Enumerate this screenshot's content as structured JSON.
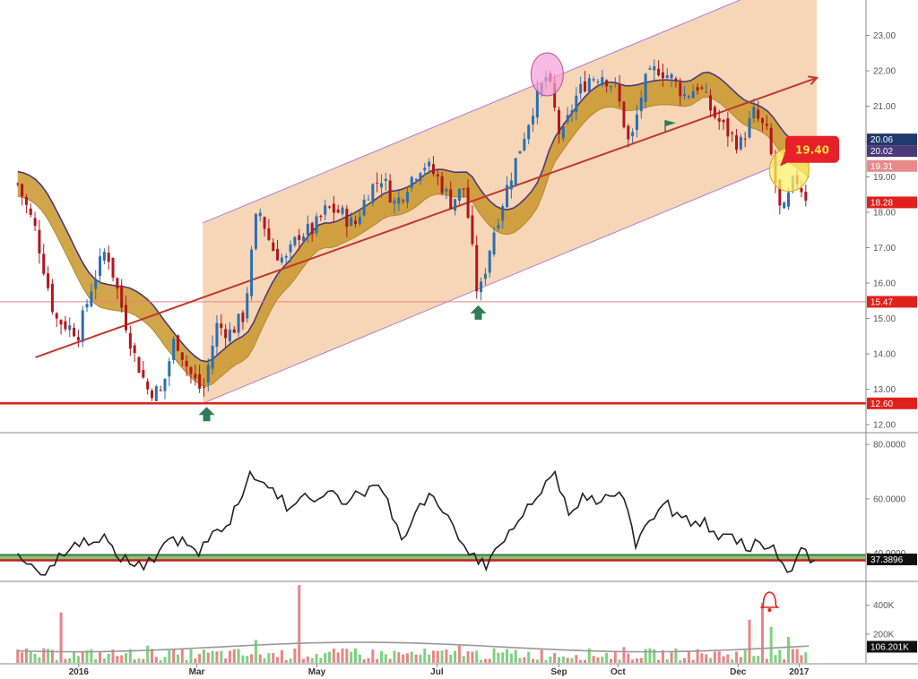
{
  "colors": {
    "channel_fill": "#f4c8a0",
    "channel_edge": "#b07ad8",
    "band_fill": "#c9962a",
    "band_edge": "#4a3a7a",
    "trend_line": "#c0392b",
    "support_line": "#e0201a",
    "candle_up": "#2a6fb0",
    "candle_down": "#b0171c",
    "vol_up": "#7ed17e",
    "vol_down": "#e98585",
    "rsi_line": "#222222",
    "rsi_band": "#8fbf7a"
  },
  "markers": {
    "arrow_up_icon": "arrow-up-icon",
    "arrow_down_icon": "arrow-down-icon",
    "flag_icon": "flag-icon",
    "bell_icon": "bell-icon"
  },
  "chart_data": [
    {
      "type": "candlestick",
      "panel": "price",
      "ylim": [
        12.0,
        24.0
      ],
      "y_ticks": [
        "24.00",
        "23.00",
        "22.00",
        "21.00",
        "20.00",
        "19.00",
        "18.00",
        "17.00",
        "16.00",
        "15.00",
        "14.00",
        "13.00",
        "12.00"
      ],
      "x_ticks": [
        "2016",
        "Mar",
        "May",
        "Jul",
        "Sep",
        "Oct",
        "Dec",
        "2017"
      ],
      "price_path": [
        [
          "2015-12-01",
          18.8
        ],
        [
          "2015-12-10",
          17.5
        ],
        [
          "2015-12-20",
          15.0
        ],
        [
          "2016-01-01",
          14.6
        ],
        [
          "2016-01-08",
          16.0
        ],
        [
          "2016-01-15",
          17.0
        ],
        [
          "2016-01-22",
          15.5
        ],
        [
          "2016-01-29",
          14.0
        ],
        [
          "2016-02-05",
          13.0
        ],
        [
          "2016-02-12",
          12.9
        ],
        [
          "2016-02-19",
          14.5
        ],
        [
          "2016-02-26",
          13.5
        ],
        [
          "2016-03-04",
          12.9
        ],
        [
          "2016-03-11",
          14.8
        ],
        [
          "2016-03-18",
          14.6
        ],
        [
          "2016-03-25",
          15.1
        ],
        [
          "2016-04-01",
          18.2
        ],
        [
          "2016-04-08",
          17.0
        ],
        [
          "2016-04-15",
          16.6
        ],
        [
          "2016-04-22",
          17.4
        ],
        [
          "2016-04-29",
          17.5
        ],
        [
          "2016-05-06",
          18.1
        ],
        [
          "2016-05-13",
          18.0
        ],
        [
          "2016-05-20",
          17.6
        ],
        [
          "2016-05-27",
          18.6
        ],
        [
          "2016-06-03",
          19.0
        ],
        [
          "2016-06-10",
          18.2
        ],
        [
          "2016-06-17",
          18.9
        ],
        [
          "2016-06-24",
          19.4
        ],
        [
          "2016-07-01",
          19.0
        ],
        [
          "2016-07-08",
          18.3
        ],
        [
          "2016-07-15",
          18.7
        ],
        [
          "2016-07-22",
          15.5
        ],
        [
          "2016-07-29",
          17.3
        ],
        [
          "2016-08-05",
          18.6
        ],
        [
          "2016-08-12",
          19.8
        ],
        [
          "2016-08-19",
          21.0
        ],
        [
          "2016-08-26",
          21.9
        ],
        [
          "2016-09-02",
          20.0
        ],
        [
          "2016-09-09",
          21.2
        ],
        [
          "2016-09-16",
          21.8
        ],
        [
          "2016-09-23",
          21.9
        ],
        [
          "2016-09-30",
          21.5
        ],
        [
          "2016-10-07",
          19.8
        ],
        [
          "2016-10-14",
          21.6
        ],
        [
          "2016-10-21",
          22.1
        ],
        [
          "2016-10-28",
          21.8
        ],
        [
          "2016-11-04",
          21.3
        ],
        [
          "2016-11-11",
          21.6
        ],
        [
          "2016-11-18",
          20.8
        ],
        [
          "2016-11-25",
          20.3
        ],
        [
          "2016-12-02",
          19.9
        ],
        [
          "2016-12-09",
          20.8
        ],
        [
          "2016-12-16",
          20.2
        ],
        [
          "2016-12-23",
          17.8
        ],
        [
          "2016-12-30",
          19.0
        ],
        [
          "2017-01-06",
          18.3
        ]
      ],
      "channel": {
        "upper_start": [
          "2016-03-04",
          17.7
        ],
        "upper_end": [
          "2016-11-21",
          24.0
        ],
        "lower_start": [
          "2016-03-04",
          12.6
        ],
        "lower_end": [
          "2017-01-10",
          19.8
        ],
        "right_edge_date": "2017-01-10"
      },
      "trend_line": {
        "start": [
          "2015-12-10",
          13.9
        ],
        "end": [
          "2017-01-10",
          21.8
        ]
      },
      "support_line_value": 12.6,
      "guide_line_value": 15.47,
      "price_labels": [
        {
          "value": 20.06,
          "label": "20.06",
          "color": "#1f3a6b"
        },
        {
          "value": 20.02,
          "label": "20.02",
          "color": "#4a3a7a"
        },
        {
          "value": 19.31,
          "label": "19.31",
          "color": "#e88a8a"
        },
        {
          "value": 18.28,
          "label": "18.28",
          "color": "#e0201a"
        },
        {
          "value": 15.47,
          "label": "15.47",
          "color": "#e0201a"
        },
        {
          "value": 12.6,
          "label": "12.60",
          "color": "#e0201a"
        }
      ],
      "callout": {
        "label": "19.40",
        "value": 19.4,
        "date": "2017-01-10"
      }
    },
    {
      "type": "line",
      "panel": "oscillator",
      "ylim": [
        30,
        84
      ],
      "y_ticks": [
        "80.0000",
        "60.0000",
        "40.0000"
      ],
      "band": [
        37.4,
        39.4
      ],
      "last_label": "37.3896",
      "path": [
        [
          "2015-12-01",
          40
        ],
        [
          "2015-12-08",
          36
        ],
        [
          "2015-12-15",
          32
        ],
        [
          "2015-12-22",
          40
        ],
        [
          "2015-12-30",
          44
        ],
        [
          "2016-01-06",
          43
        ],
        [
          "2016-01-14",
          47
        ],
        [
          "2016-01-20",
          39
        ],
        [
          "2016-01-27",
          36
        ],
        [
          "2016-02-03",
          34
        ],
        [
          "2016-02-11",
          41
        ],
        [
          "2016-02-18",
          46
        ],
        [
          "2016-02-25",
          43
        ],
        [
          "2016-03-02",
          39
        ],
        [
          "2016-03-09",
          48
        ],
        [
          "2016-03-16",
          50
        ],
        [
          "2016-03-22",
          58
        ],
        [
          "2016-03-28",
          70
        ],
        [
          "2016-04-04",
          66
        ],
        [
          "2016-04-11",
          60
        ],
        [
          "2016-04-18",
          57
        ],
        [
          "2016-04-25",
          62
        ],
        [
          "2016-05-02",
          60
        ],
        [
          "2016-05-09",
          63
        ],
        [
          "2016-05-16",
          58
        ],
        [
          "2016-05-23",
          62
        ],
        [
          "2016-05-30",
          65
        ],
        [
          "2016-06-06",
          60
        ],
        [
          "2016-06-13",
          45
        ],
        [
          "2016-06-20",
          55
        ],
        [
          "2016-06-27",
          62
        ],
        [
          "2016-07-04",
          55
        ],
        [
          "2016-07-12",
          45
        ],
        [
          "2016-07-20",
          40
        ],
        [
          "2016-07-26",
          34
        ],
        [
          "2016-08-02",
          43
        ],
        [
          "2016-08-09",
          49
        ],
        [
          "2016-08-16",
          58
        ],
        [
          "2016-08-23",
          62
        ],
        [
          "2016-08-30",
          70
        ],
        [
          "2016-09-06",
          54
        ],
        [
          "2016-09-13",
          62
        ],
        [
          "2016-09-20",
          58
        ],
        [
          "2016-09-27",
          61
        ],
        [
          "2016-10-04",
          60
        ],
        [
          "2016-10-10",
          42
        ],
        [
          "2016-10-17",
          52
        ],
        [
          "2016-10-24",
          58
        ],
        [
          "2016-10-31",
          55
        ],
        [
          "2016-11-07",
          50
        ],
        [
          "2016-11-14",
          53
        ],
        [
          "2016-11-21",
          45
        ],
        [
          "2016-11-28",
          47
        ],
        [
          "2016-12-05",
          41
        ],
        [
          "2016-12-12",
          44
        ],
        [
          "2016-12-19",
          43
        ],
        [
          "2016-12-26",
          33
        ],
        [
          "2017-01-02",
          42
        ],
        [
          "2017-01-09",
          37.4
        ]
      ]
    },
    {
      "type": "bar",
      "panel": "volume",
      "ylim": [
        0,
        560000
      ],
      "y_ticks": [
        "400K",
        "200K"
      ],
      "last_label": "106.201K",
      "peaks": [
        [
          "2015-12-22",
          350000,
          "down"
        ],
        [
          "2016-02-05",
          120000,
          "up"
        ],
        [
          "2016-03-30",
          160000,
          "up"
        ],
        [
          "2016-04-21",
          540000,
          "down"
        ],
        [
          "2016-05-20",
          100000,
          "up"
        ],
        [
          "2016-07-12",
          120000,
          "down"
        ],
        [
          "2016-08-10",
          90000,
          "up"
        ],
        [
          "2016-10-05",
          110000,
          "down"
        ],
        [
          "2016-12-07",
          300000,
          "down"
        ],
        [
          "2016-12-14",
          420000,
          "down"
        ],
        [
          "2016-12-18",
          250000,
          "up"
        ],
        [
          "2016-12-26",
          180000,
          "up"
        ]
      ],
      "baseline": 60000,
      "avg_level": 110000
    }
  ]
}
